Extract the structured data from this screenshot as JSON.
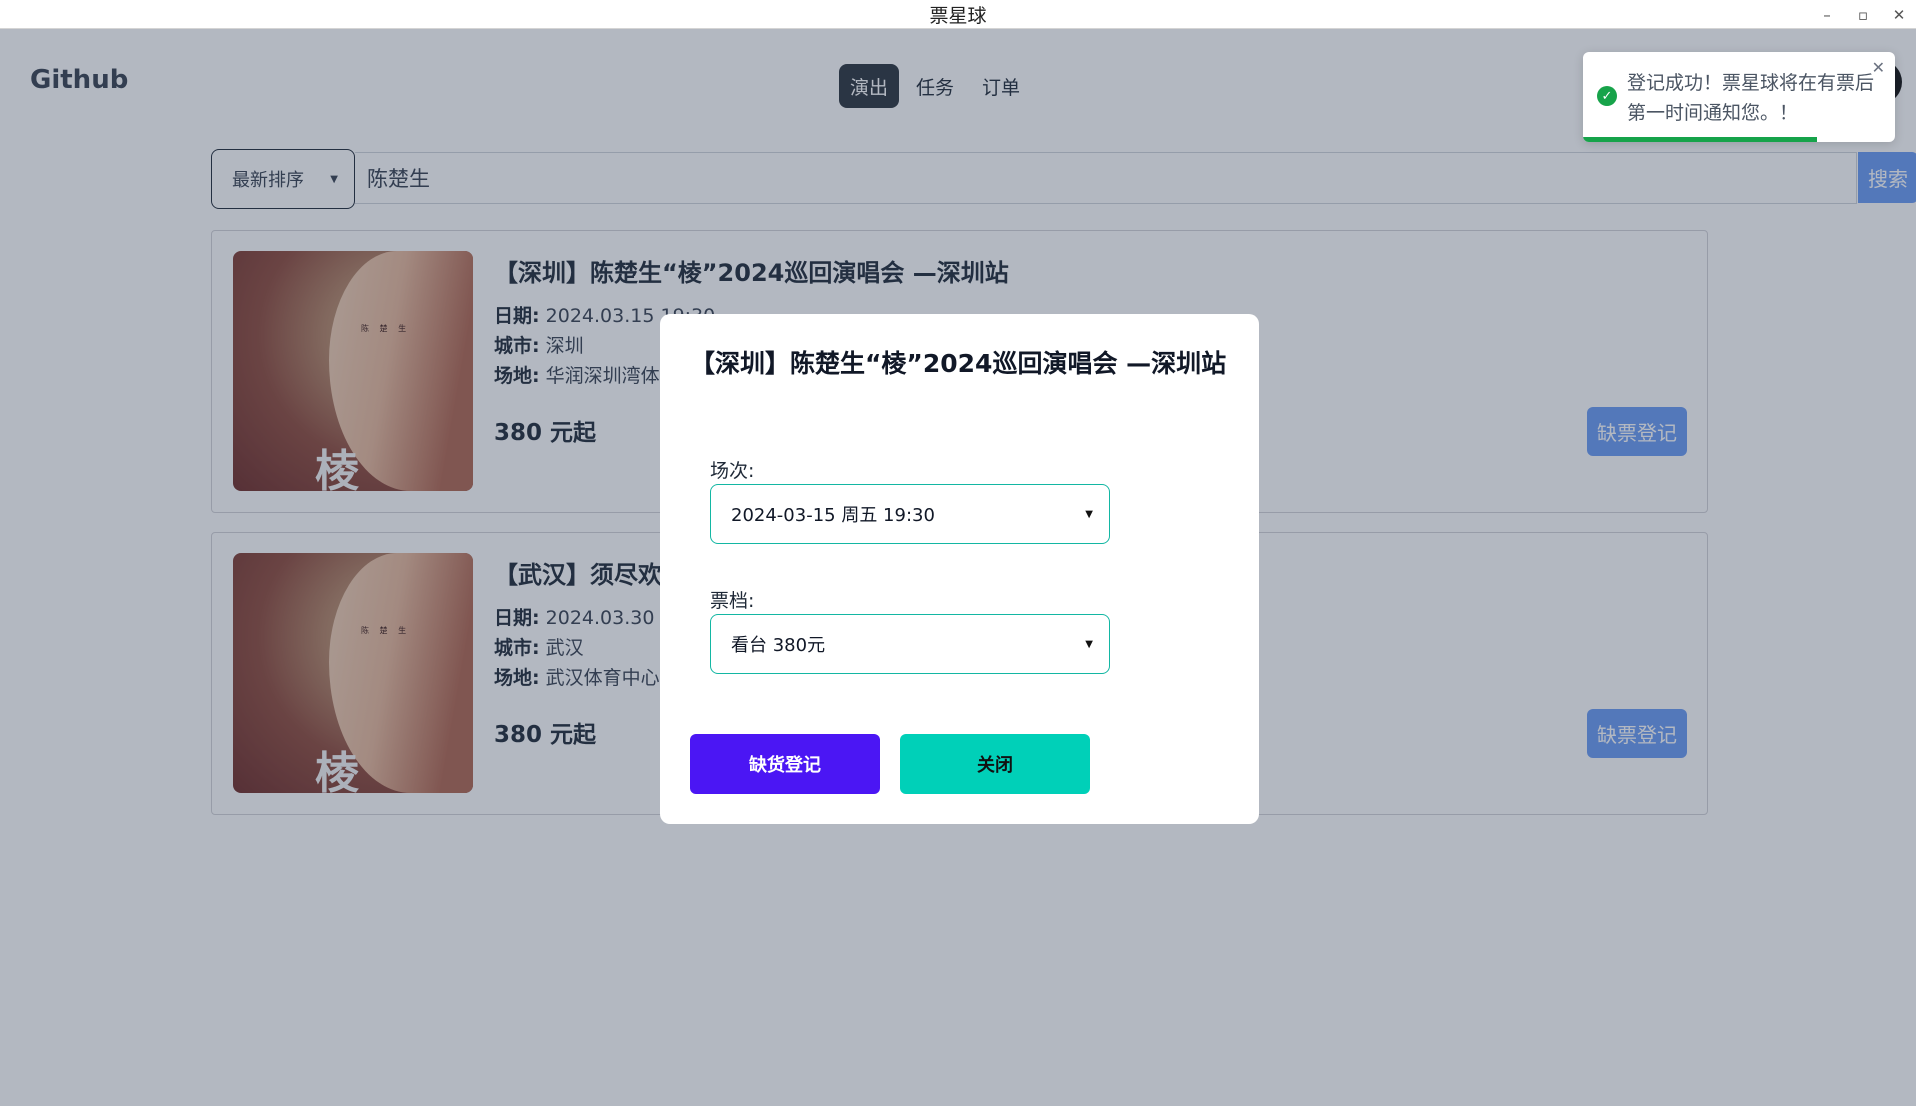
{
  "window": {
    "title": "票星球"
  },
  "header": {
    "logo": "Github",
    "tabs": [
      {
        "label": "演出",
        "active": true
      },
      {
        "label": "任务",
        "active": false
      },
      {
        "label": "订单",
        "active": false
      }
    ]
  },
  "search": {
    "sort_label": "最新排序",
    "query": "陈楚生",
    "button_label": "搜索"
  },
  "events": [
    {
      "title": "【深圳】陈楚生“棱”2024巡回演唱会 —深圳站",
      "date_label": "日期:",
      "date": "2024.03.15 19:30",
      "city_label": "城市:",
      "city": "深圳",
      "venue_label": "场地:",
      "venue": "华润深圳湾体",
      "price": "380 元起",
      "button": "缺票登记"
    },
    {
      "title": "【武汉】须尽欢",
      "date_label": "日期:",
      "date": "2024.03.30 1",
      "city_label": "城市:",
      "city": "武汉",
      "venue_label": "场地:",
      "venue": "武汉体育中心",
      "price": "380 元起",
      "button": "缺票登记"
    }
  ],
  "modal": {
    "title": "【深圳】陈楚生“棱”2024巡回演唱会 —深圳站",
    "session_label": "场次:",
    "session_value": "2024-03-15 周五 19:30",
    "tier_label": "票档:",
    "tier_value": "看台 380元",
    "confirm_button": "缺货登记",
    "close_button": "关闭"
  },
  "toast": {
    "message": "登记成功！票星球将在有票后第一时间通知您。！",
    "progress": 0.75,
    "status_color": "#16a34a"
  },
  "colors": {
    "accent_blue": "#6a9bf4",
    "primary_purple": "#4b16f4",
    "teal": "#00d0b8",
    "active_tab": "#2a323c"
  }
}
